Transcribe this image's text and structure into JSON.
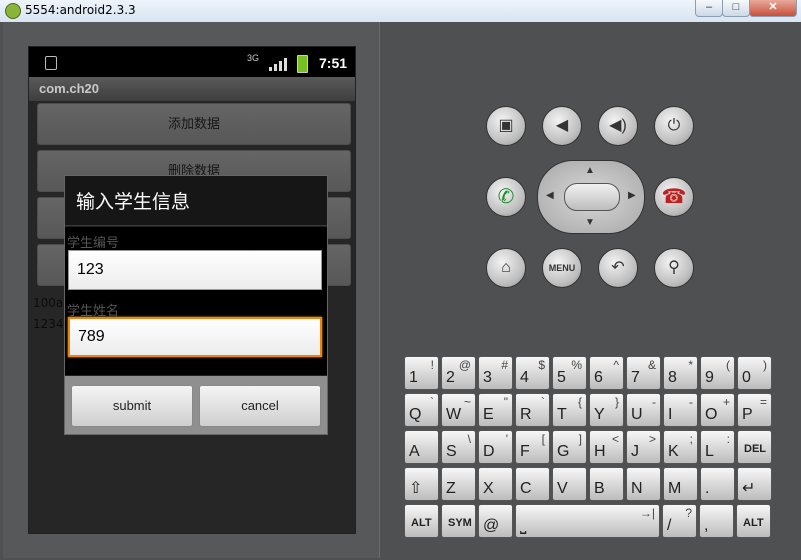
{
  "window": {
    "title": "5554:android2.3.3",
    "min": "–",
    "max": "□",
    "close": "✕"
  },
  "statusbar": {
    "time": "7:51",
    "net_label": "3G"
  },
  "app": {
    "title": "com.ch20",
    "buttons": [
      "添加数据",
      "删除数据",
      "",
      ""
    ],
    "list": [
      "100a",
      "1234"
    ]
  },
  "dialog": {
    "title": "输入学生信息",
    "field1": {
      "label": "学生编号",
      "value": "123"
    },
    "field2": {
      "label": "学生姓名",
      "value": "789"
    },
    "submit": "submit",
    "cancel": "cancel"
  },
  "controls": {
    "menu": "MENU",
    "icons": [
      "camera-icon",
      "volume-down-icon",
      "volume-up-icon",
      "power-icon",
      "call-icon",
      "end-call-icon",
      "home-icon",
      "menu-icon",
      "back-icon",
      "search-icon"
    ]
  },
  "keyboard": {
    "row1": [
      [
        "1",
        "!"
      ],
      [
        "2",
        "@"
      ],
      [
        "3",
        "#"
      ],
      [
        "4",
        "$"
      ],
      [
        "5",
        "%"
      ],
      [
        "6",
        "^"
      ],
      [
        "7",
        "&"
      ],
      [
        "8",
        "*"
      ],
      [
        "9",
        "("
      ],
      [
        "0",
        ")"
      ]
    ],
    "row2": [
      [
        "Q",
        "`"
      ],
      [
        "W",
        "~"
      ],
      [
        "E",
        "\""
      ],
      [
        "R",
        "`"
      ],
      [
        "T",
        "{"
      ],
      [
        "Y",
        "}"
      ],
      [
        "U",
        "-"
      ],
      [
        "I",
        "-"
      ],
      [
        "O",
        "+"
      ],
      [
        "P",
        "="
      ]
    ],
    "row3": [
      [
        "A",
        ""
      ],
      [
        "S",
        "\\"
      ],
      [
        "D",
        "'"
      ],
      [
        "F",
        "["
      ],
      [
        "G",
        "]"
      ],
      [
        "H",
        "<"
      ],
      [
        "J",
        ">"
      ],
      [
        "K",
        ";"
      ],
      [
        "L",
        ":"
      ],
      [
        "DEL",
        ""
      ]
    ],
    "row4": [
      [
        "⇧",
        ""
      ],
      [
        "Z",
        ""
      ],
      [
        "X",
        ""
      ],
      [
        "C",
        ""
      ],
      [
        "V",
        ""
      ],
      [
        "B",
        ""
      ],
      [
        "N",
        ""
      ],
      [
        "M",
        ""
      ],
      [
        ".",
        ""
      ],
      [
        "↵",
        ""
      ]
    ],
    "row5": [
      [
        "ALT",
        ""
      ],
      [
        "SYM",
        ""
      ],
      [
        "@",
        ""
      ],
      [
        "⎵",
        "→|"
      ],
      [
        "/",
        "?"
      ],
      [
        ",",
        ""
      ],
      [
        "ALT",
        ""
      ]
    ]
  }
}
